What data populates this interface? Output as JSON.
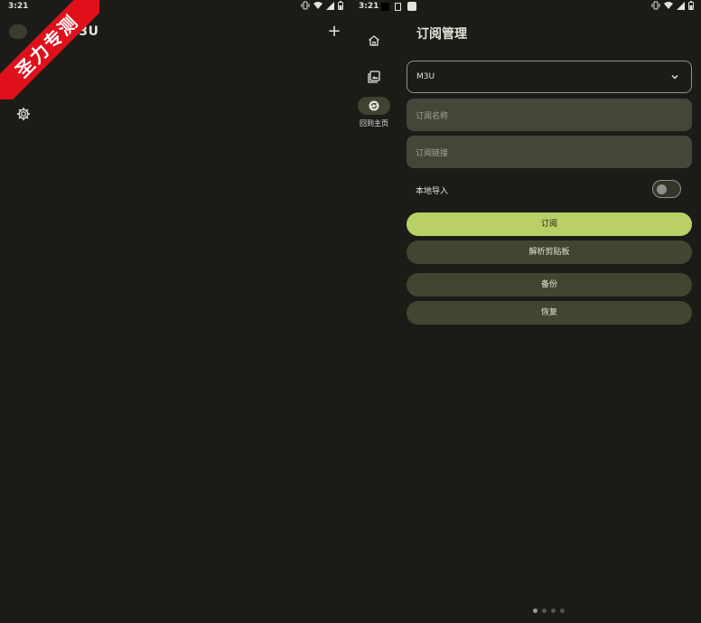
{
  "left": {
    "status_time": "3:21",
    "title": "M3U",
    "add_label": "+",
    "watermark": "圣力专测",
    "nav_icons": [
      "avatar-icon",
      "gallery-icon",
      "gear-icon"
    ]
  },
  "right": {
    "status_time": "3:21",
    "title": "订阅管理",
    "rail": {
      "items": [
        {
          "icon": "home-icon"
        },
        {
          "icon": "gallery-icon"
        },
        {
          "icon": "refresh-icon",
          "label": "回到主页",
          "active": true
        }
      ]
    },
    "form": {
      "type_value": "M3U",
      "name_placeholder": "订阅名称",
      "url_placeholder": "订阅链接",
      "local_import_label": "本地导入",
      "local_import_on": false
    },
    "buttons": {
      "subscribe": "订阅",
      "parse_clipboard": "解析剪贴板",
      "backup": "备份",
      "restore": "恢复"
    },
    "pager": {
      "count": 4,
      "active": 0
    }
  },
  "colors": {
    "background": "#1b1c17",
    "primary": "#b9d066",
    "tonal": "#424631",
    "field": "#44463a",
    "watermark": "#e0101b"
  }
}
